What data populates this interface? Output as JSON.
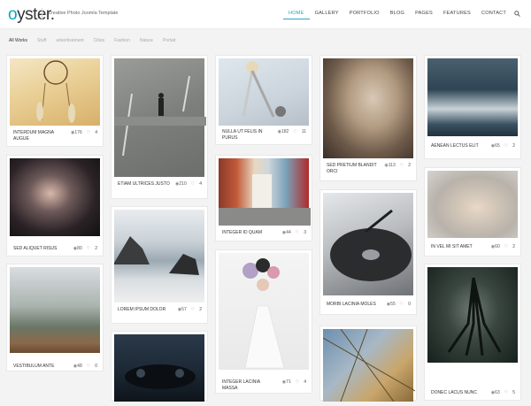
{
  "header": {
    "logo_first": "o",
    "logo_rest": "yster.",
    "tagline": "Creative Photo Joomla Template",
    "nav": [
      "HOME",
      "GALLERY",
      "PORTFOLIO",
      "BLOG",
      "PAGES",
      "FEATURES",
      "CONTACT"
    ],
    "search_icon": "search-icon"
  },
  "filters": [
    "All Works",
    "Stuff",
    "advertisement",
    "Cities",
    "Fashion",
    "Nature",
    "Portait"
  ],
  "cards": [
    {
      "title": "INTERDUM MAGNA AUGUE",
      "views": "176",
      "likes": "4"
    },
    {
      "title": "SED ALIQUET RISUS",
      "views": "80",
      "likes": "2"
    },
    {
      "title": "VESTIBULUM ANTE",
      "views": "48",
      "likes": "0"
    },
    {
      "title": "ETIAM ULTRICES JUSTO",
      "views": "210",
      "likes": "4"
    },
    {
      "title": "LOREM IPSUM DOLOR",
      "views": "57",
      "likes": "2"
    },
    {
      "title": "NULLA UT FELIS IN PURUS",
      "views": "182",
      "likes": "11"
    },
    {
      "title": "INTEGER ID QUAM",
      "views": "44",
      "likes": "3"
    },
    {
      "title": "INTEGER LACINIA MASSA",
      "views": "71",
      "likes": "4"
    },
    {
      "title": "SED PRETIUM BLANDIT ORCI",
      "views": "113",
      "likes": "2"
    },
    {
      "title": "MORBI LACINIA MOLES",
      "views": "55",
      "likes": "0"
    },
    {
      "title": "AENEAN LECTUS ELIT",
      "views": "65",
      "likes": "2"
    },
    {
      "title": "IN VEL MI SIT AMET",
      "views": "60",
      "likes": "2"
    },
    {
      "title": "DONEC LACUS NUNC",
      "views": "63",
      "likes": "5"
    }
  ],
  "colors": {
    "accent": "#2aa6c0",
    "heart": "#e0557a"
  }
}
